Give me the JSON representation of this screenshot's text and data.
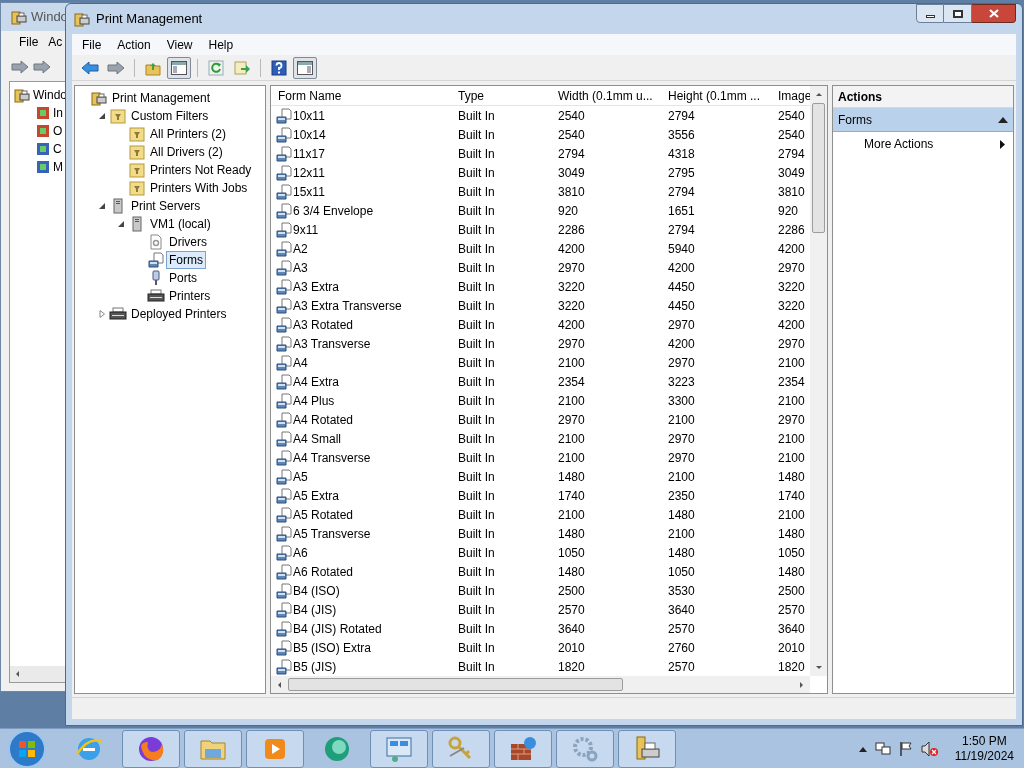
{
  "back_window": {
    "title": "Windo",
    "menu": [
      "File",
      "Ac"
    ],
    "tree": [
      {
        "label": "Windo",
        "kind": "root"
      },
      {
        "label": "In",
        "kind": "red"
      },
      {
        "label": "O",
        "kind": "red"
      },
      {
        "label": "C",
        "kind": "blue"
      },
      {
        "label": "M",
        "kind": "blue"
      }
    ]
  },
  "window": {
    "title": "Print Management"
  },
  "menu": [
    "File",
    "Action",
    "View",
    "Help"
  ],
  "toolbar": [
    {
      "kind": "back",
      "pressed": false
    },
    {
      "kind": "forward",
      "pressed": false
    },
    {
      "kind": "sep"
    },
    {
      "kind": "up",
      "pressed": false
    },
    {
      "kind": "tree",
      "pressed": true
    },
    {
      "kind": "sep"
    },
    {
      "kind": "refresh",
      "pressed": false
    },
    {
      "kind": "export",
      "pressed": false
    },
    {
      "kind": "sep"
    },
    {
      "kind": "help",
      "pressed": false
    },
    {
      "kind": "pane",
      "pressed": true
    }
  ],
  "tree": [
    {
      "label": "Print Management",
      "kind": "root",
      "selected": false,
      "children": [
        {
          "label": "Custom Filters",
          "kind": "filters",
          "expanded": true,
          "selected": false,
          "children": [
            {
              "label": "All Printers (2)",
              "kind": "filter",
              "selected": false
            },
            {
              "label": "All Drivers (2)",
              "kind": "filter",
              "selected": false
            },
            {
              "label": "Printers Not Ready",
              "kind": "filter",
              "selected": false
            },
            {
              "label": "Printers With Jobs",
              "kind": "filter",
              "selected": false
            }
          ]
        },
        {
          "label": "Print Servers",
          "kind": "server",
          "expanded": true,
          "selected": false,
          "children": [
            {
              "label": "VM1 (local)",
              "kind": "server",
              "expanded": true,
              "selected": false,
              "children": [
                {
                  "label": "Drivers",
                  "kind": "drivers",
                  "selected": false
                },
                {
                  "label": "Forms",
                  "kind": "forms",
                  "selected": true
                },
                {
                  "label": "Ports",
                  "kind": "ports",
                  "selected": false
                },
                {
                  "label": "Printers",
                  "kind": "printers",
                  "selected": false
                }
              ]
            }
          ]
        },
        {
          "label": "Deployed Printers",
          "kind": "printers",
          "expanded": false,
          "selected": false
        }
      ]
    }
  ],
  "table": {
    "columns": [
      "Form Name",
      "Type",
      "Width (0.1mm u...",
      "Height (0.1mm ...",
      "Image"
    ],
    "rows": [
      [
        "10x11",
        "Built In",
        "2540",
        "2794",
        "2540"
      ],
      [
        "10x14",
        "Built In",
        "2540",
        "3556",
        "2540"
      ],
      [
        "11x17",
        "Built In",
        "2794",
        "4318",
        "2794"
      ],
      [
        "12x11",
        "Built In",
        "3049",
        "2795",
        "3049"
      ],
      [
        "15x11",
        "Built In",
        "3810",
        "2794",
        "3810"
      ],
      [
        "6 3/4 Envelope",
        "Built In",
        "920",
        "1651",
        "920"
      ],
      [
        "9x11",
        "Built In",
        "2286",
        "2794",
        "2286"
      ],
      [
        "A2",
        "Built In",
        "4200",
        "5940",
        "4200"
      ],
      [
        "A3",
        "Built In",
        "2970",
        "4200",
        "2970"
      ],
      [
        "A3 Extra",
        "Built In",
        "3220",
        "4450",
        "3220"
      ],
      [
        "A3 Extra Transverse",
        "Built In",
        "3220",
        "4450",
        "3220"
      ],
      [
        "A3 Rotated",
        "Built In",
        "4200",
        "2970",
        "4200"
      ],
      [
        "A3 Transverse",
        "Built In",
        "2970",
        "4200",
        "2970"
      ],
      [
        "A4",
        "Built In",
        "2100",
        "2970",
        "2100"
      ],
      [
        "A4 Extra",
        "Built In",
        "2354",
        "3223",
        "2354"
      ],
      [
        "A4 Plus",
        "Built In",
        "2100",
        "3300",
        "2100"
      ],
      [
        "A4 Rotated",
        "Built In",
        "2970",
        "2100",
        "2970"
      ],
      [
        "A4 Small",
        "Built In",
        "2100",
        "2970",
        "2100"
      ],
      [
        "A4 Transverse",
        "Built In",
        "2100",
        "2970",
        "2100"
      ],
      [
        "A5",
        "Built In",
        "1480",
        "2100",
        "1480"
      ],
      [
        "A5 Extra",
        "Built In",
        "1740",
        "2350",
        "1740"
      ],
      [
        "A5 Rotated",
        "Built In",
        "2100",
        "1480",
        "2100"
      ],
      [
        "A5 Transverse",
        "Built In",
        "1480",
        "2100",
        "1480"
      ],
      [
        "A6",
        "Built In",
        "1050",
        "1480",
        "1050"
      ],
      [
        "A6 Rotated",
        "Built In",
        "1480",
        "1050",
        "1480"
      ],
      [
        "B4 (ISO)",
        "Built In",
        "2500",
        "3530",
        "2500"
      ],
      [
        "B4 (JIS)",
        "Built In",
        "2570",
        "3640",
        "2570"
      ],
      [
        "B4 (JIS) Rotated",
        "Built In",
        "3640",
        "2570",
        "3640"
      ],
      [
        "B5 (ISO) Extra",
        "Built In",
        "2010",
        "2760",
        "2010"
      ],
      [
        "B5 (JIS)",
        "Built In",
        "1820",
        "2570",
        "1820"
      ]
    ]
  },
  "actions": {
    "title": "Actions",
    "sections": [
      {
        "title": "Forms",
        "expanded": true,
        "items": [
          "More Actions"
        ]
      }
    ]
  },
  "taskbar": {
    "apps": [
      {
        "kind": "ie",
        "running": false
      },
      {
        "kind": "firefox",
        "running": true
      },
      {
        "kind": "explorer",
        "running": true
      },
      {
        "kind": "media",
        "running": true
      },
      {
        "kind": "circle",
        "running": false
      },
      {
        "kind": "panel",
        "running": true
      },
      {
        "kind": "keys",
        "running": true
      },
      {
        "kind": "firewall",
        "running": true
      },
      {
        "kind": "gears",
        "running": true
      },
      {
        "kind": "printmgmt",
        "running": true
      }
    ],
    "time": "1:50 PM",
    "date": "11/19/2024"
  }
}
